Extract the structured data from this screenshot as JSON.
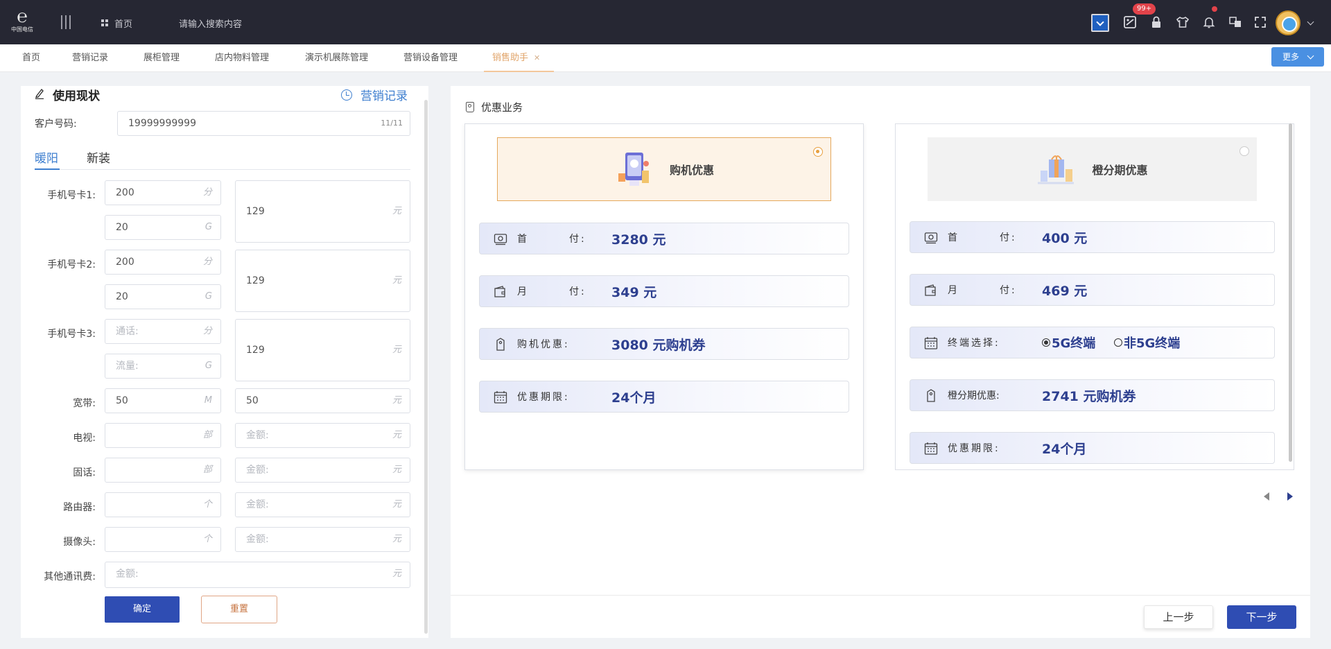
{
  "topbar": {
    "logo_text": "中国电信",
    "home_label": "首页",
    "search_placeholder": "请输入搜索内容",
    "notification_badge": "99+"
  },
  "tabs": [
    {
      "label": "首页"
    },
    {
      "label": "营销记录"
    },
    {
      "label": "展柜管理"
    },
    {
      "label": "店内物料管理"
    },
    {
      "label": "演示机展陈管理"
    },
    {
      "label": "营销设备管理"
    },
    {
      "label": "销售助手",
      "active": true
    }
  ],
  "more_label": "更多",
  "left": {
    "title": "使用现状",
    "record_link": "营销记录",
    "customer_label": "客户号码:",
    "customer_number": "19999999999",
    "customer_counter": "11/11",
    "subtabs": [
      "暖阳",
      "新装"
    ],
    "card1_label": "手机号卡1:",
    "card1_call": "200",
    "card1_flow": "20",
    "card1_fee": "129",
    "card2_label": "手机号卡2:",
    "card2_call": "200",
    "card2_flow": "20",
    "card2_fee": "129",
    "card3_label": "手机号卡3:",
    "card3_call_ph": "通话:",
    "card3_flow_ph": "流量:",
    "card3_fee": "129",
    "broadband_label": "宽带:",
    "broadband_speed": "50",
    "broadband_fee": "50",
    "tv_label": "电视:",
    "landline_label": "固话:",
    "router_label": "路由器:",
    "camera_label": "摄像头:",
    "other_label": "其他通讯费:",
    "amount_ph": "金额:",
    "units": {
      "fen": "分",
      "g": "G",
      "yuan": "元",
      "m": "M",
      "bu": "部",
      "ge": "个"
    },
    "confirm": "确定",
    "reset": "重置"
  },
  "right": {
    "title": "优惠业务",
    "offer1": {
      "name": "购机优惠",
      "selected": true,
      "down_label_a": "首",
      "down_label_b": "付:",
      "down_value": "3280 元",
      "month_label_a": "月",
      "month_label_b": "付:",
      "month_value": "349 元",
      "discount_label": "购机优惠:",
      "discount_value": "3080 元购机券",
      "term_label": "优惠期限:",
      "term_value": "24个月"
    },
    "offer2": {
      "name": "橙分期优惠",
      "selected": false,
      "down_label_a": "首",
      "down_label_b": "付:",
      "down_value": "400 元",
      "month_label_a": "月",
      "month_label_b": "付:",
      "month_value": "469 元",
      "terminal_label": "终端选择:",
      "terminal_opt1": "5G终端",
      "terminal_opt2": "非5G终端",
      "installment_label": "橙分期优惠:",
      "installment_value": "2741 元购机券",
      "term_label": "优惠期限:",
      "term_value": "24个月"
    },
    "prev_step": "上一步",
    "next_step": "下一步"
  },
  "colors": {
    "accent": "#2f4db3",
    "topbar": "#262733",
    "selected_border": "#e5a85c",
    "value_text": "#2d3f8f"
  }
}
